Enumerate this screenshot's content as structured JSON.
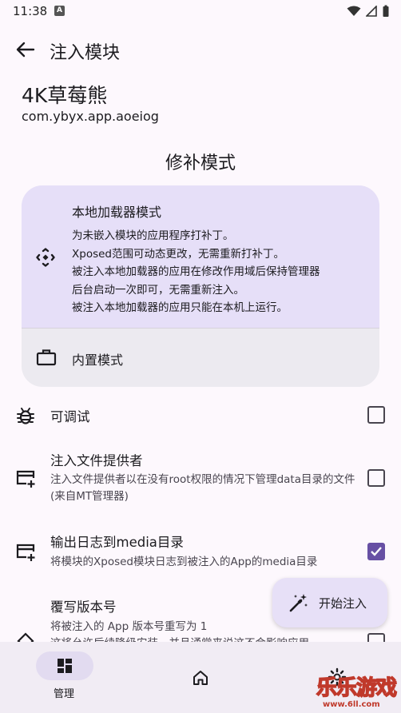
{
  "status_bar": {
    "time": "11:38",
    "notification_badge": "A"
  },
  "app_bar": {
    "title": "注入模块"
  },
  "app_info": {
    "name": "4K草莓熊",
    "package": "com.ybyx.app.aoeiog"
  },
  "patch_mode": {
    "section_title": "修补模式",
    "local": {
      "title": "本地加载器模式",
      "desc": [
        "为未嵌入模块的应用程序打补丁。",
        "Xposed范围可动态更改，无需重新打补丁。",
        "被注入本地加载器的应用在修改作用域后保持管理器",
        "后台启动一次即可，无需重新注入。",
        "被注入本地加载器的应用只能在本机上运行。"
      ]
    },
    "builtin": {
      "title": "内置模式"
    }
  },
  "options": [
    {
      "title": "可调试",
      "desc": "",
      "checked": false,
      "icon": "bug-icon"
    },
    {
      "title": "注入文件提供者",
      "desc": "注入文件提供者以在没有root权限的情况下管理data目录的文件(来自MT管理器)",
      "checked": false,
      "icon": "card-add-icon"
    },
    {
      "title": "输出日志到media目录",
      "desc": "将模块的Xposed模块日志到被注入的App的media目录",
      "checked": true,
      "icon": "card-add-icon"
    },
    {
      "title": "覆写版本号",
      "desc": "将被注入的 App 版本号重写为 1",
      "desc2": "这将允许后续降级安装，并且通常来说这不会影响应用",
      "checked": false,
      "icon": "version-icon"
    }
  ],
  "fab": {
    "label": "开始注入",
    "icon": "magic-wand-icon"
  },
  "bottom_nav": [
    {
      "label": "管理",
      "icon": "dashboard-icon",
      "selected": true
    },
    {
      "label": "",
      "icon": "home-icon",
      "selected": false
    },
    {
      "label": "",
      "icon": "gear-icon",
      "selected": false
    }
  ],
  "watermark": {
    "text": "乐乐游戏",
    "url": "www.6ll.com"
  },
  "colors": {
    "accent": "#6750a4",
    "card_selected": "#e6dff8",
    "card": "#eceaf0",
    "background": "#fdf8fd",
    "nav": "#f1ecf4"
  }
}
